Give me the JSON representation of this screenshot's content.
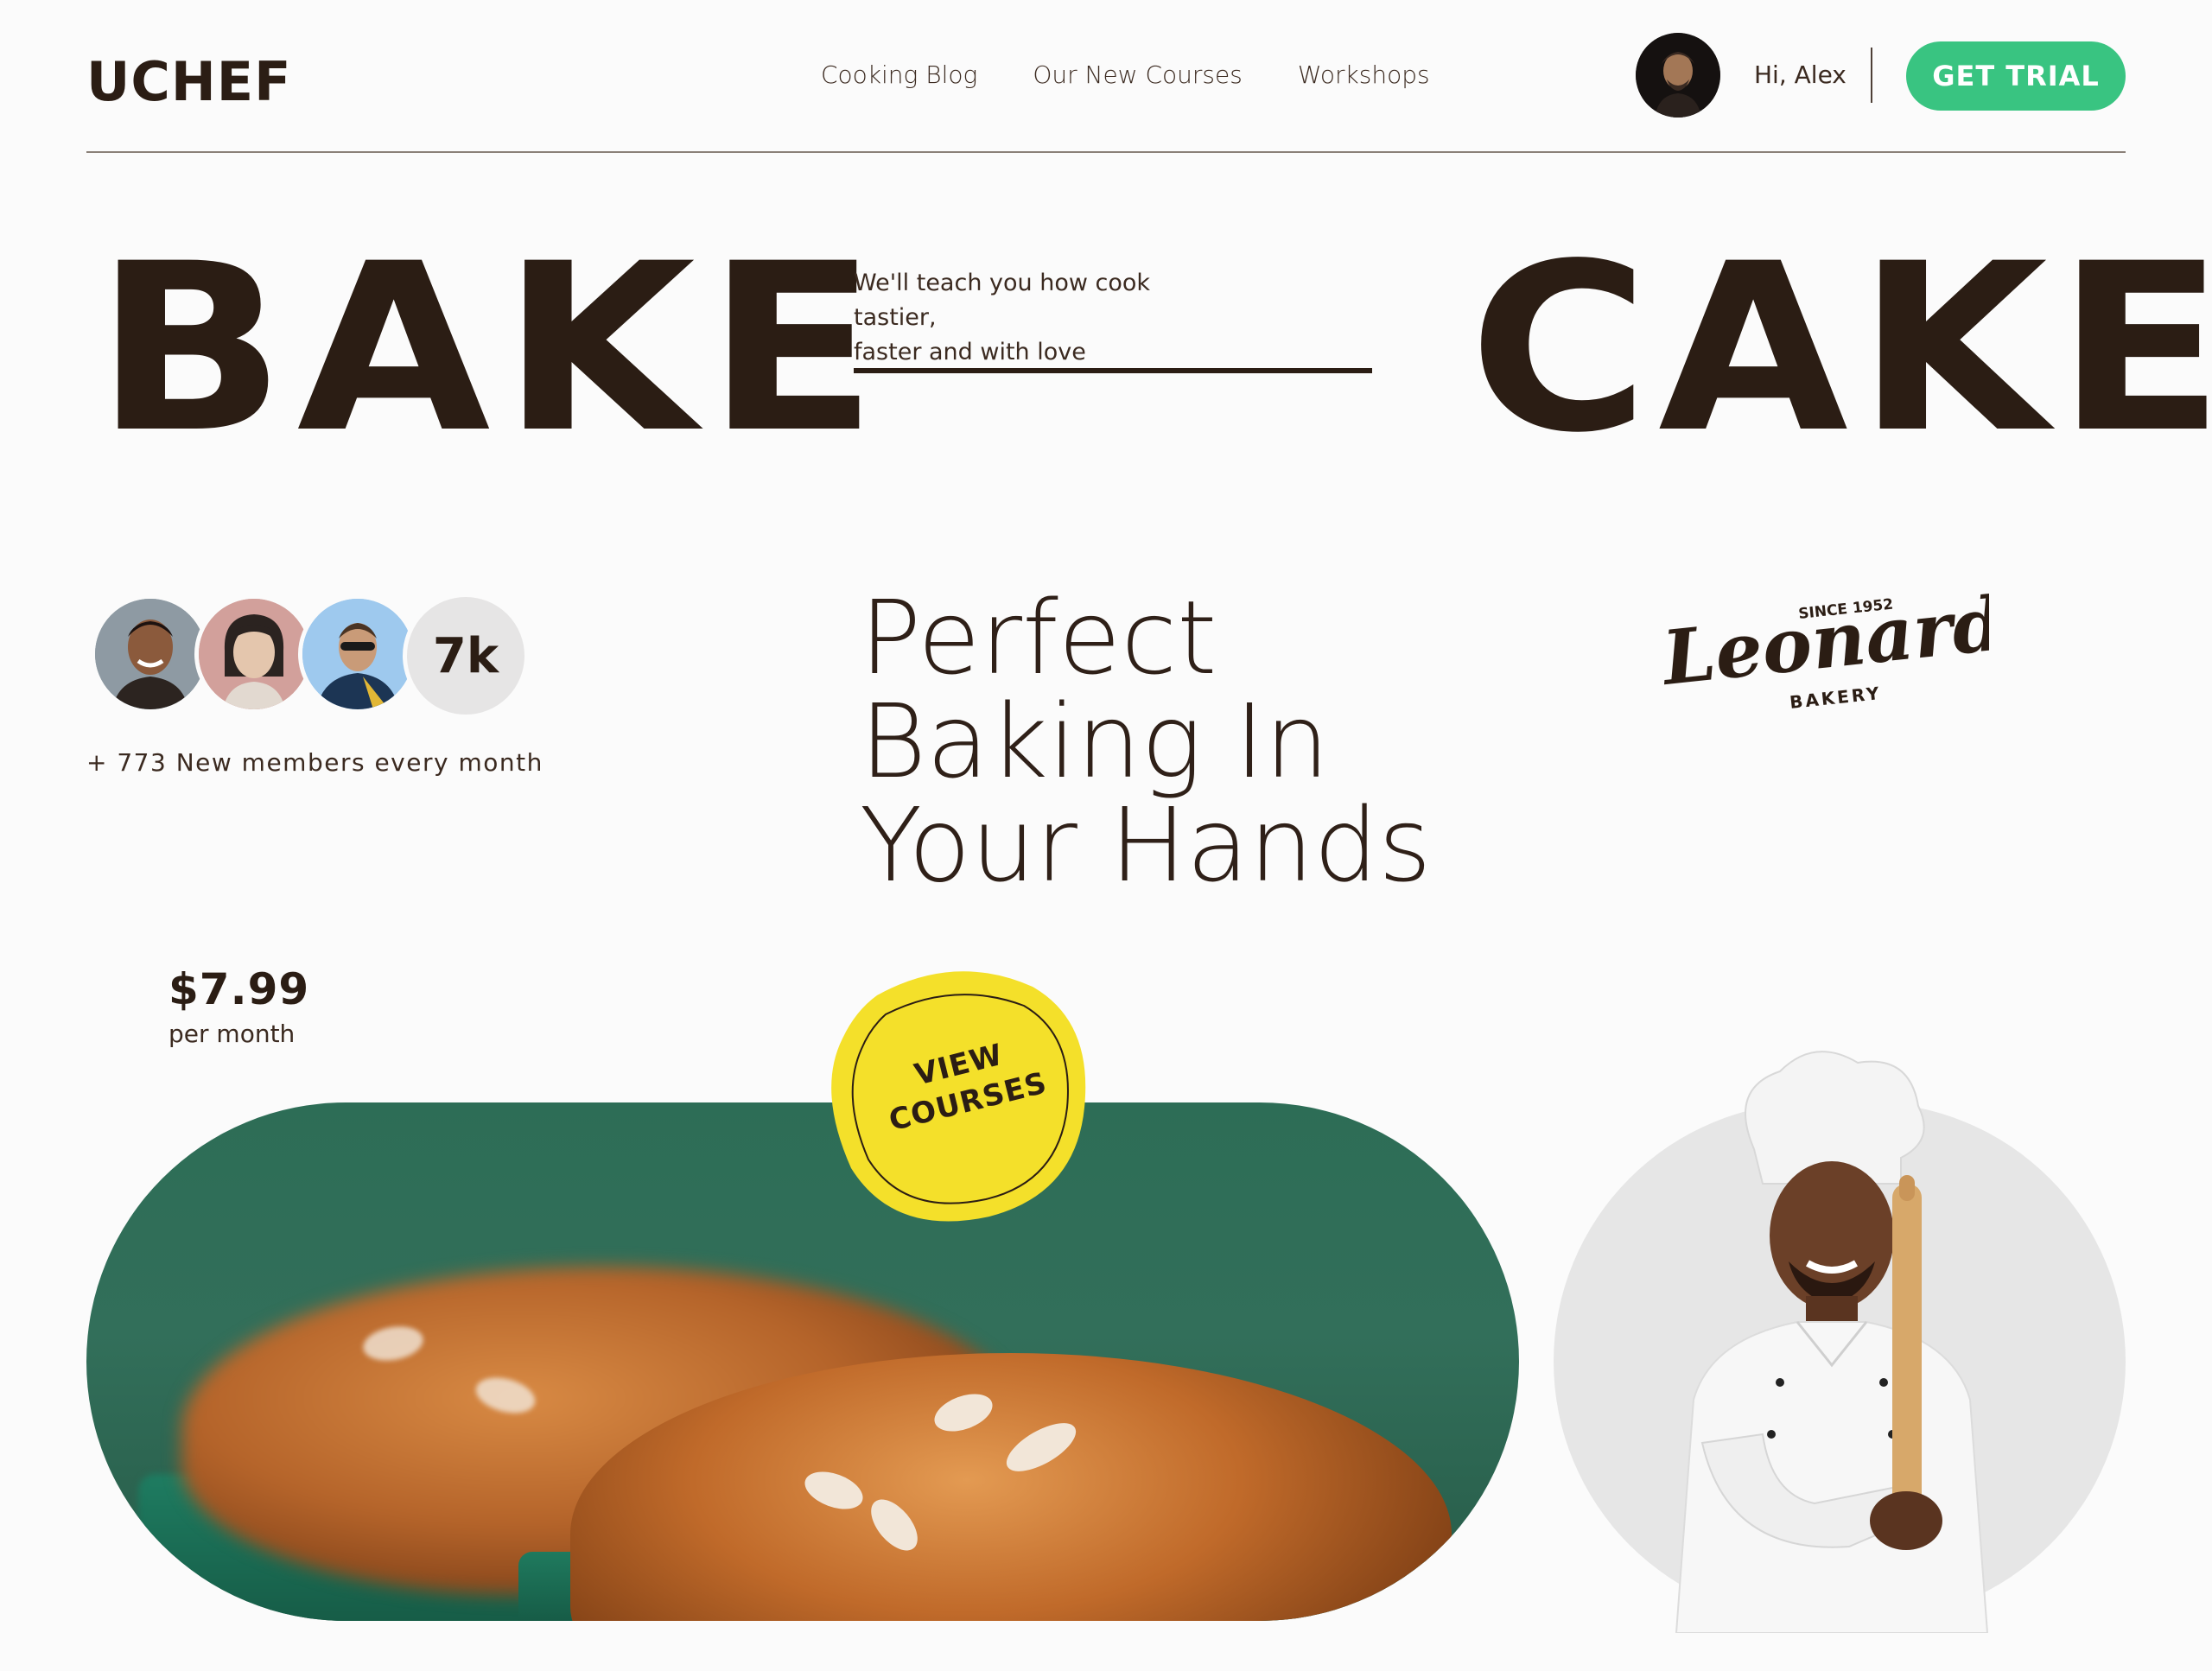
{
  "header": {
    "logo": "UCHEF",
    "nav": [
      "Cooking Blog",
      "Our New Courses",
      "Workshops"
    ],
    "greeting": "Hi, Alex",
    "cta": "GET TRIAL"
  },
  "hero": {
    "word_left": "BAKE",
    "word_right": "CAKE",
    "tagline_line1": "We'll teach you how cook tastier,",
    "tagline_line2": "faster and with love"
  },
  "members": {
    "count_badge": "7k",
    "text": "+ 773 New members every month"
  },
  "headline": {
    "line1": "Perfect",
    "line2": "Baking In",
    "line3": "Your Hands"
  },
  "partner_logo": {
    "brand": "Leonard's",
    "since": "SINCE 1952",
    "sub": "BAKERY"
  },
  "pricing": {
    "price": "$7.99",
    "period": "per month"
  },
  "badge": {
    "line1": "VIEW",
    "line2": "COURSES"
  },
  "colors": {
    "accent_green": "#39c481",
    "badge_yellow": "#f4e02a",
    "text_dark": "#2b1d14"
  }
}
